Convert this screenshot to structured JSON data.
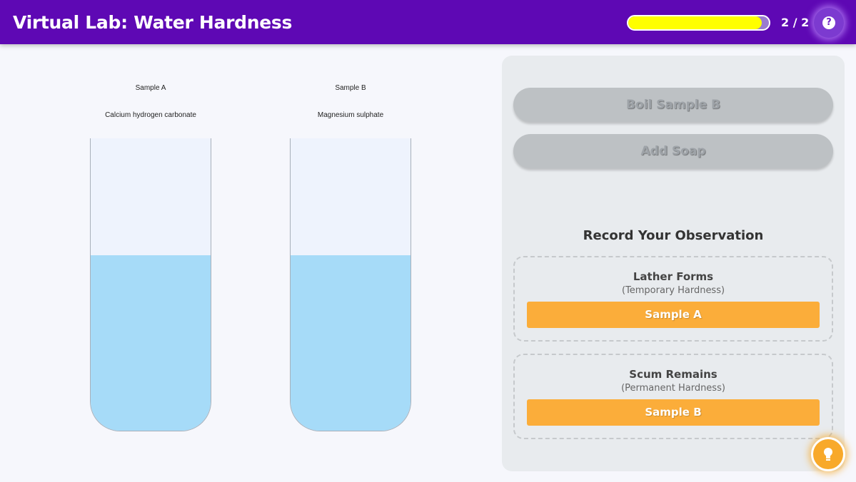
{
  "header": {
    "title": "Virtual Lab: Water Hardness",
    "progress_fraction": 0.95,
    "progress_text": "2 / 2",
    "help_glyph": "?",
    "help_icon": "question-mark-icon"
  },
  "samples": [
    {
      "name": "Sample A",
      "compound": "Calcium hydrogen carbonate",
      "liquid_fill_fraction": 0.6
    },
    {
      "name": "Sample B",
      "compound": "Magnesium sulphate",
      "liquid_fill_fraction": 0.6
    }
  ],
  "actions": {
    "boil_label": "Boil Sample B",
    "soap_label": "Add Soap"
  },
  "observation": {
    "title": "Record Your Observation",
    "options": [
      {
        "heading": "Lather Forms",
        "subtitle": "(Temporary Hardness)",
        "button": "Sample A"
      },
      {
        "heading": "Scum Remains",
        "subtitle": "(Permanent Hardness)",
        "button": "Sample B"
      }
    ]
  },
  "hint_icon": "lightbulb-icon",
  "colors": {
    "header_bg": "#5e08b4",
    "progress_fill": "#ffff00",
    "liquid": "#a6dbf8",
    "orange_button": "#fbad3a",
    "disabled_button": "#bdc1c4"
  }
}
